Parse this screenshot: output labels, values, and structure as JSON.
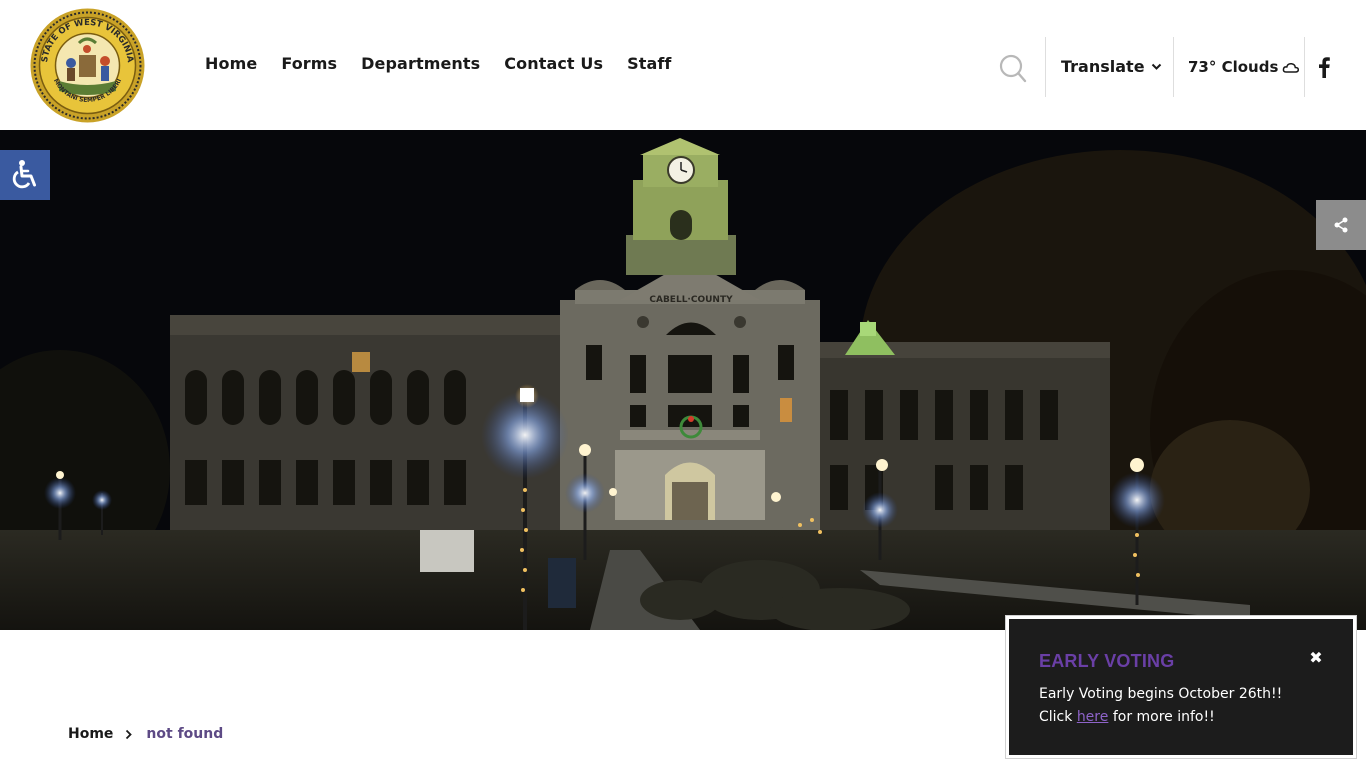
{
  "header": {
    "logo_text": "STATE OF WEST VIRGINIA",
    "logo_motto": "MONTANI SEMPER LIBERI",
    "nav": [
      {
        "label": "Home"
      },
      {
        "label": "Forms"
      },
      {
        "label": "Departments"
      },
      {
        "label": "Contact Us"
      },
      {
        "label": "Staff"
      }
    ],
    "translate_label": "Translate",
    "weather": "73° Clouds"
  },
  "hero": {
    "building_sign": "CABELL·COUNTY"
  },
  "breadcrumb": {
    "home": "Home",
    "current": "not found"
  },
  "popup": {
    "title": "EARLY VOTING",
    "close": "✖",
    "line1": "Early Voting begins October 26th!!",
    "line2_prefix": "Click ",
    "line2_link": "here",
    "line2_suffix": " for more info!!"
  },
  "colors": {
    "accent_purple": "#6a3fa6",
    "access_blue": "#3a5aa0",
    "share_grey": "#8c8c8c",
    "popup_bg": "#1c1c1c"
  },
  "icons": {
    "search": "search-icon",
    "chevron": "chevron-down-icon",
    "weather": "cloud-icon",
    "facebook": "facebook-icon",
    "accessibility": "wheelchair-icon",
    "share": "share-icon",
    "breadcrumb_sep": "chevron-right-icon"
  }
}
